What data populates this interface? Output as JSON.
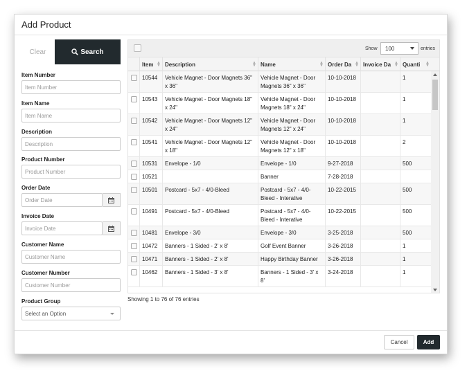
{
  "modal": {
    "title": "Add Product"
  },
  "filters": {
    "clear_label": "Clear",
    "search_label": "Search",
    "fields": [
      {
        "label": "Item Number",
        "placeholder": "Item Number",
        "type": "text"
      },
      {
        "label": "Item Name",
        "placeholder": "Item Name",
        "type": "text"
      },
      {
        "label": "Description",
        "placeholder": "Description",
        "type": "text"
      },
      {
        "label": "Product Number",
        "placeholder": "Product Number",
        "type": "text"
      },
      {
        "label": "Order Date",
        "placeholder": "Order Date",
        "type": "date"
      },
      {
        "label": "Invoice Date",
        "placeholder": "Invoice Date",
        "type": "date"
      },
      {
        "label": "Customer Name",
        "placeholder": "Customer Name",
        "type": "text"
      },
      {
        "label": "Customer Number",
        "placeholder": "Customer Number",
        "type": "text"
      },
      {
        "label": "Product Group",
        "placeholder": "Select an Option",
        "type": "select"
      }
    ]
  },
  "grid": {
    "show_label": "Show",
    "page_size": "100",
    "entries_label": "entries",
    "columns": [
      "Item",
      "Description",
      "Name",
      "Order Da",
      "Invoice Da",
      "Quanti"
    ],
    "rows": [
      [
        "10544",
        "Vehicle Magnet - Door Magnets 36\" x 36\"",
        "Vehicle Magnet - Door Magnets 36\" x 36\"",
        "10-10-2018",
        "",
        "1"
      ],
      [
        "10543",
        "Vehicle Magnet - Door Magnets 18\" x 24\"",
        "Vehicle Magnet - Door Magnets 18\" x 24\"",
        "10-10-2018",
        "",
        "1"
      ],
      [
        "10542",
        "Vehicle Magnet - Door Magnets 12\" x 24\"",
        "Vehicle Magnet - Door Magnets 12\" x 24\"",
        "10-10-2018",
        "",
        "1"
      ],
      [
        "10541",
        "Vehicle Magnet - Door Magnets 12\" x 18\"",
        "Vehicle Magnet - Door Magnets 12\" x 18\"",
        "10-10-2018",
        "",
        "2"
      ],
      [
        "10531",
        "Envelope - 1/0",
        "Envelope - 1/0",
        "9-27-2018",
        "",
        "500"
      ],
      [
        "10521",
        "",
        "Banner",
        "7-28-2018",
        "",
        ""
      ],
      [
        "10501",
        "Postcard - 5x7 - 4/0-Bleed",
        "Postcard - 5x7 - 4/0-Bleed - Interative",
        "10-22-2015",
        "",
        "500"
      ],
      [
        "10491",
        "Postcard - 5x7 - 4/0-Bleed",
        "Postcard - 5x7 - 4/0-Bleed - Interative",
        "10-22-2015",
        "",
        "500"
      ],
      [
        "10481",
        "Envelope - 3/0",
        "Envelope - 3/0",
        "3-25-2018",
        "",
        "500"
      ],
      [
        "10472",
        "Banners - 1 Sided - 2' x 8'",
        "Golf Event Banner",
        "3-26-2018",
        "",
        "1"
      ],
      [
        "10471",
        "Banners - 1 Sided - 2' x 8'",
        "Happy Birthday Banner",
        "3-26-2018",
        "",
        "1"
      ],
      [
        "10462",
        "Banners - 1 Sided - 3' x 8'",
        "Banners - 1 Sided - 3' x 8'",
        "3-24-2018",
        "",
        "1"
      ]
    ],
    "summary": "Showing 1 to 76 of 76 entries"
  },
  "footer": {
    "cancel_label": "Cancel",
    "add_label": "Add"
  },
  "colors": {
    "dark_button": "#222a2e",
    "header_bg": "#f4f4f4"
  },
  "icons": {
    "search": "search-icon",
    "calendar": "calendar-icon"
  }
}
